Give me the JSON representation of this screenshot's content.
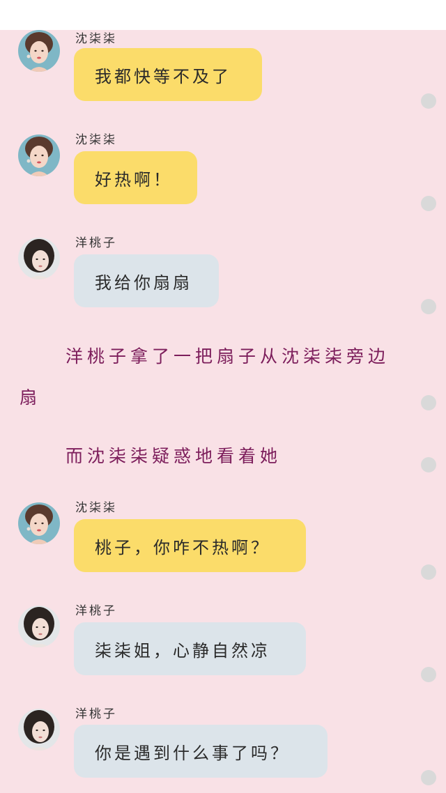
{
  "colors": {
    "chat_background": "#f9e1e6",
    "bubble_yellow": "#fbdc6a",
    "bubble_blue": "#dce4ea",
    "narration_text": "#7c1d5b"
  },
  "messages": [
    {
      "sender": "沈柒柒",
      "text": "我都快等不及了",
      "bubble_color": "yellow",
      "avatar": "shen-qiqi-avatar"
    },
    {
      "sender": "沈柒柒",
      "text": "好热啊！",
      "bubble_color": "yellow",
      "avatar": "shen-qiqi-avatar"
    },
    {
      "sender": "洋桃子",
      "text": "我给你扇扇",
      "bubble_color": "blue",
      "avatar": "yang-taozi-avatar"
    },
    {
      "sender": "沈柒柒",
      "text": "桃子，你咋不热啊？",
      "bubble_color": "yellow",
      "avatar": "shen-qiqi-avatar"
    },
    {
      "sender": "洋桃子",
      "text": "柒柒姐，心静自然凉",
      "bubble_color": "blue",
      "avatar": "yang-taozi-avatar"
    },
    {
      "sender": "洋桃子",
      "text": "你是遇到什么事了吗？",
      "bubble_color": "blue",
      "avatar": "yang-taozi-avatar"
    }
  ],
  "narrations": [
    {
      "line1": "洋桃子拿了一把扇子从沈柒柒旁边",
      "line2": "扇"
    },
    {
      "line1": "而沈柒柒疑惑地看着她"
    }
  ]
}
